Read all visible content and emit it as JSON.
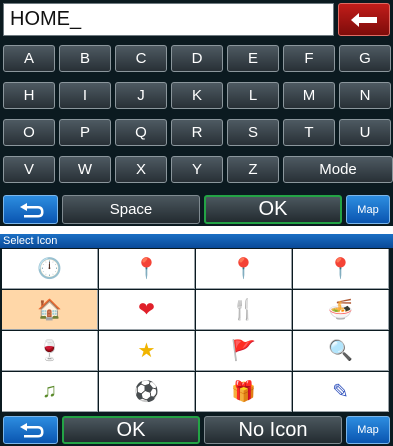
{
  "keyboard": {
    "input_value": "HOME_",
    "backspace_icon": "left-arrow-icon",
    "rows": [
      [
        "A",
        "B",
        "C",
        "D",
        "E",
        "F",
        "G"
      ],
      [
        "H",
        "I",
        "J",
        "K",
        "L",
        "M",
        "N"
      ],
      [
        "O",
        "P",
        "Q",
        "R",
        "S",
        "T",
        "U"
      ],
      [
        "V",
        "W",
        "X",
        "Y",
        "Z"
      ]
    ],
    "mode_label": "Mode",
    "back_icon": "return-arrow-icon",
    "space_label": "Space",
    "ok_label": "OK",
    "map_label": "Map"
  },
  "icon_picker": {
    "title": "Select Icon",
    "selected_index": 4,
    "icons": [
      {
        "name": "clock-yellow-pin-icon",
        "glyph": "🕛"
      },
      {
        "name": "blue-pin-icon",
        "glyph": "📍"
      },
      {
        "name": "red-pin-icon",
        "glyph": "📍"
      },
      {
        "name": "purple-pin-icon",
        "glyph": "📍"
      },
      {
        "name": "house-icon",
        "glyph": "🏠"
      },
      {
        "name": "heart-icon",
        "glyph": "❤"
      },
      {
        "name": "fork-knife-icon",
        "glyph": "🍴"
      },
      {
        "name": "food-bowl-icon",
        "glyph": "🍜"
      },
      {
        "name": "wine-bottle-icon",
        "glyph": "🍷"
      },
      {
        "name": "star-icon",
        "glyph": "★"
      },
      {
        "name": "red-flag-icon",
        "glyph": "🚩"
      },
      {
        "name": "magnifier-icon",
        "glyph": "🔍"
      },
      {
        "name": "music-note-icon",
        "glyph": "♫"
      },
      {
        "name": "soccer-ball-icon",
        "glyph": "⚽"
      },
      {
        "name": "gift-icon",
        "glyph": "🎁"
      },
      {
        "name": "pencil-icon",
        "glyph": "✎"
      }
    ],
    "back_icon": "return-arrow-icon",
    "ok_label": "OK",
    "no_icon_label": "No Icon",
    "map_label": "Map"
  }
}
